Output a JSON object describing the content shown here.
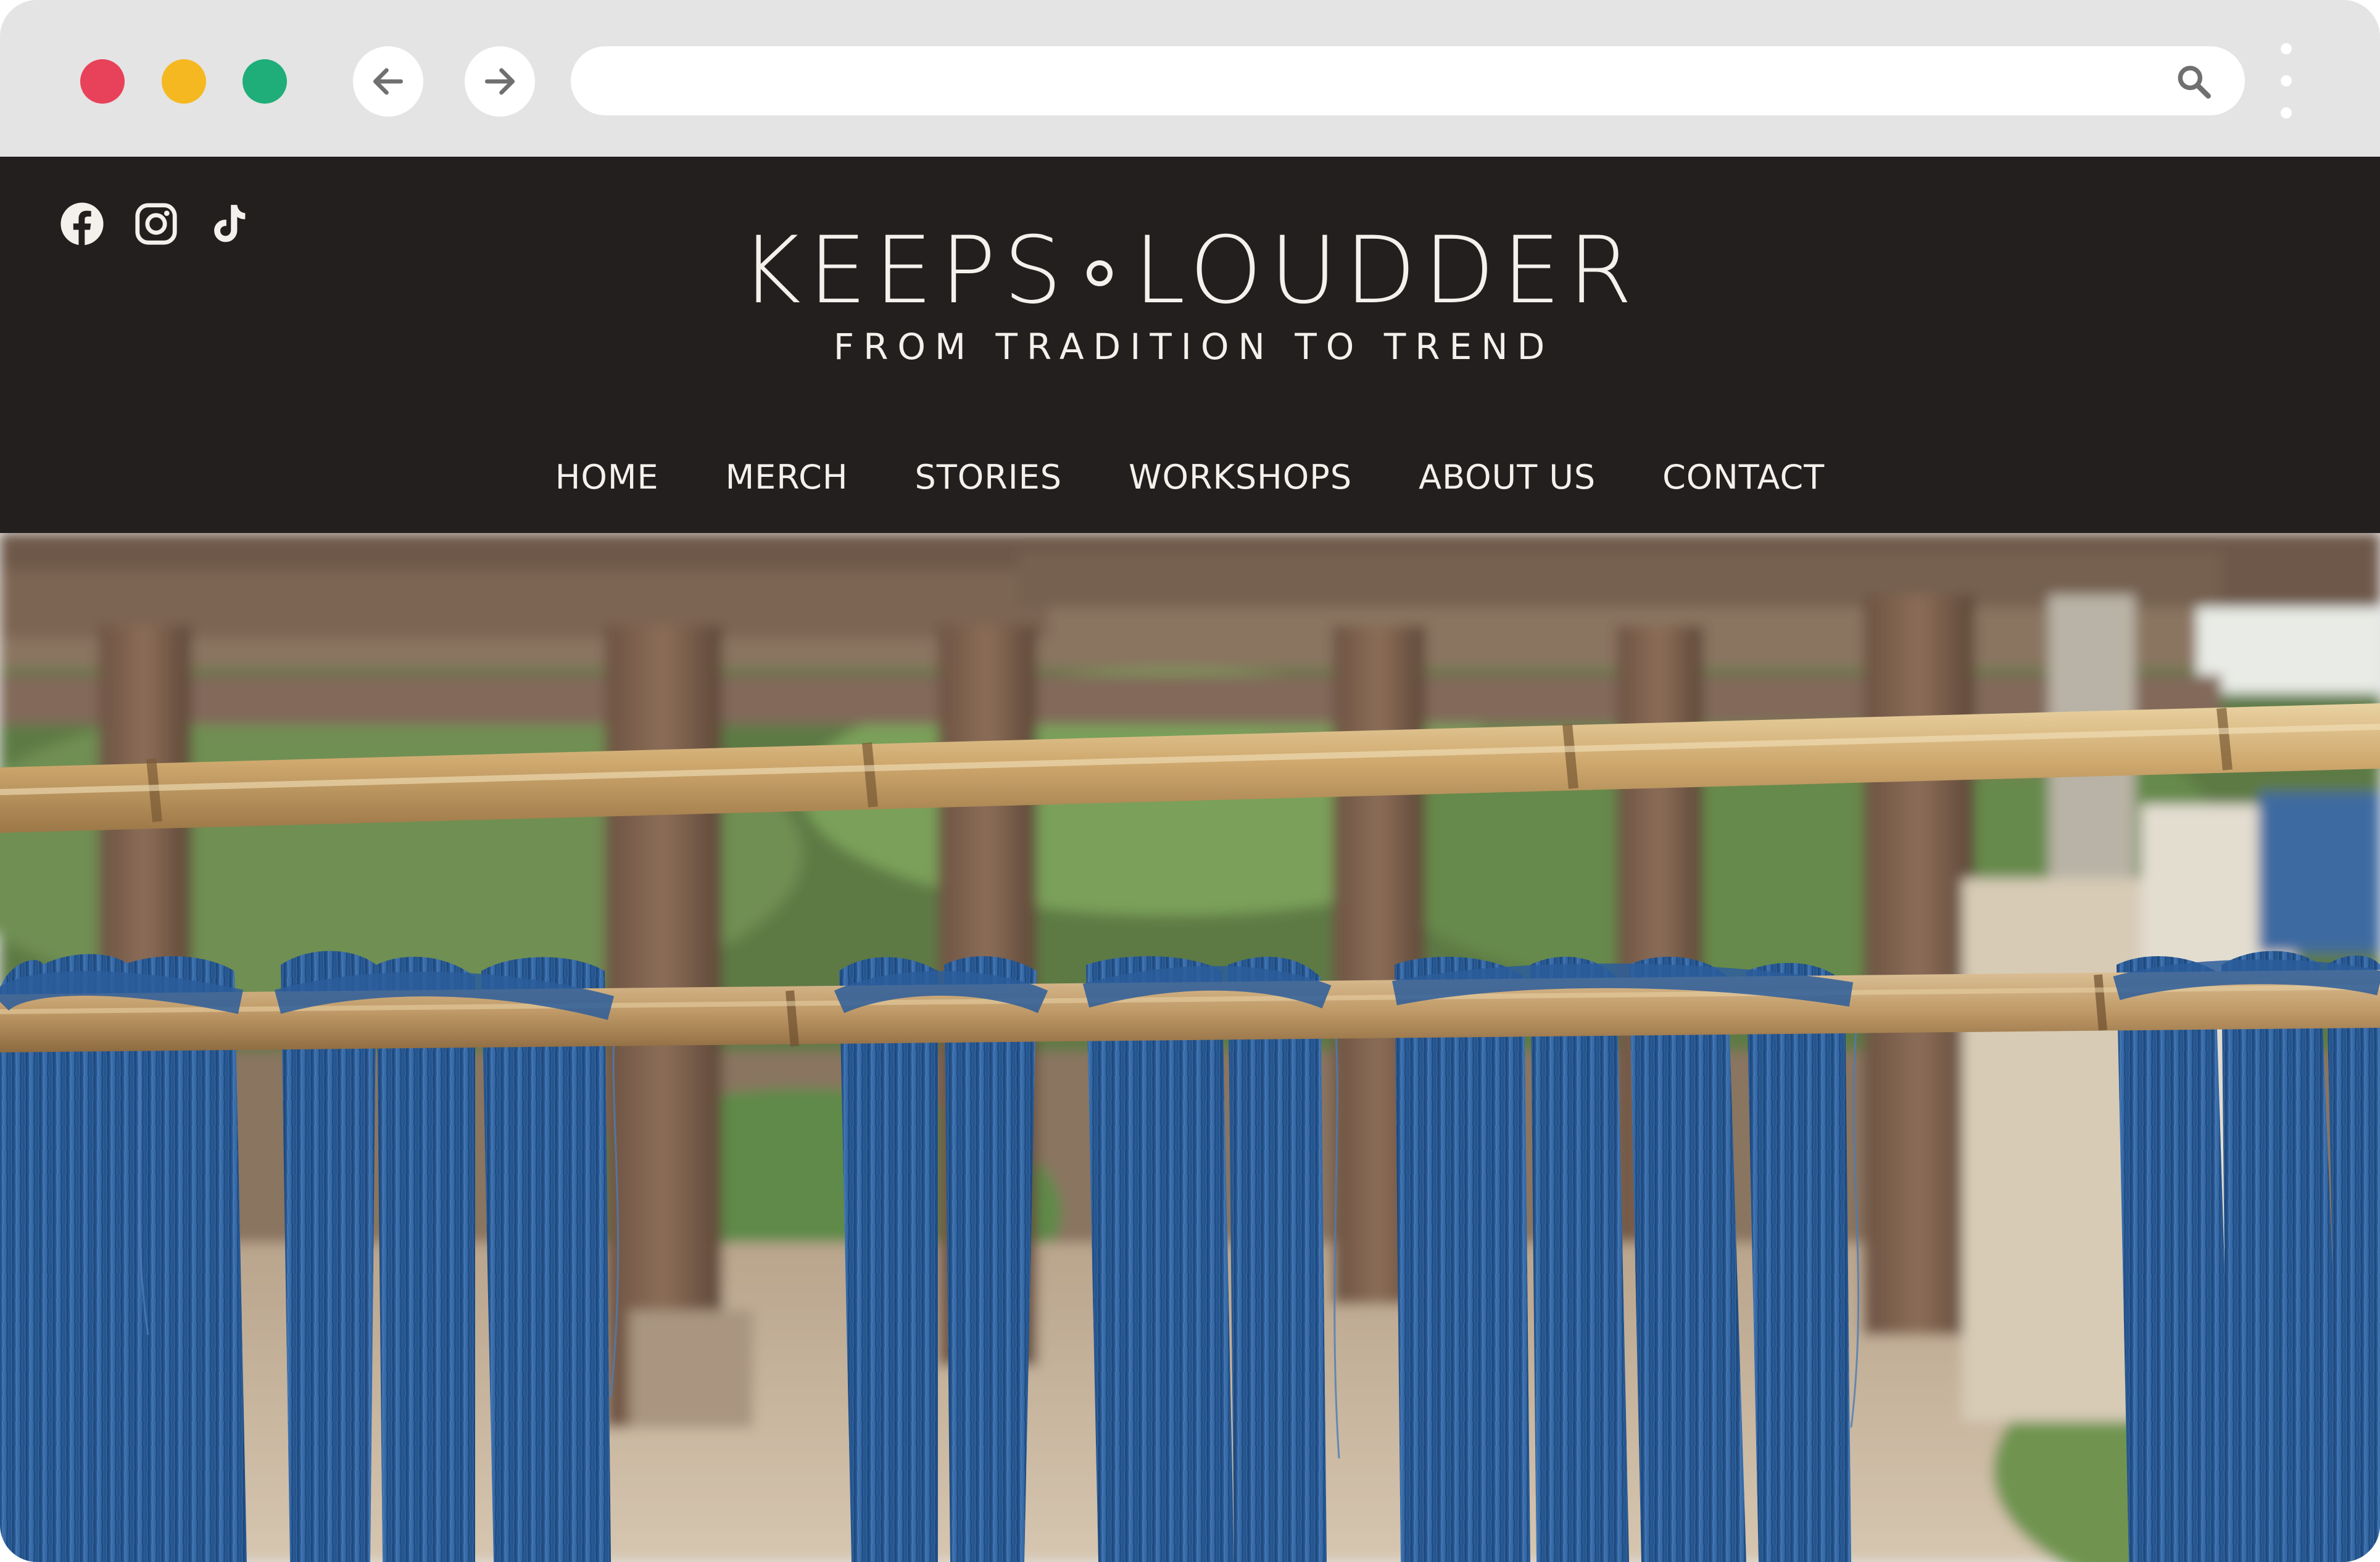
{
  "browser": {
    "url": "",
    "controls": {
      "close_color": "#e8425a",
      "minimize_color": "#f5b821",
      "maximize_color": "#1fae7a"
    },
    "icons": [
      "arrow-left-icon",
      "arrow-right-icon",
      "search-icon",
      "more-vertical-icon"
    ]
  },
  "site": {
    "logo": {
      "word_left": "KEEPS",
      "word_right": "LOUDDER",
      "tagline": "FROM TRADITION TO TREND"
    },
    "social": [
      "facebook-icon",
      "instagram-icon",
      "tiktok-icon"
    ],
    "nav": [
      {
        "label": "HOME"
      },
      {
        "label": "MERCH"
      },
      {
        "label": "STORIES"
      },
      {
        "label": "WORKSHOPS"
      },
      {
        "label": "ABOUT US"
      },
      {
        "label": "CONTACT"
      }
    ],
    "colors": {
      "header_bg": "#231f1e",
      "header_text": "#f4f1ec",
      "indigo": "#2f5e9a"
    }
  },
  "hero": {
    "icon": "indigo-yarn-photo"
  }
}
